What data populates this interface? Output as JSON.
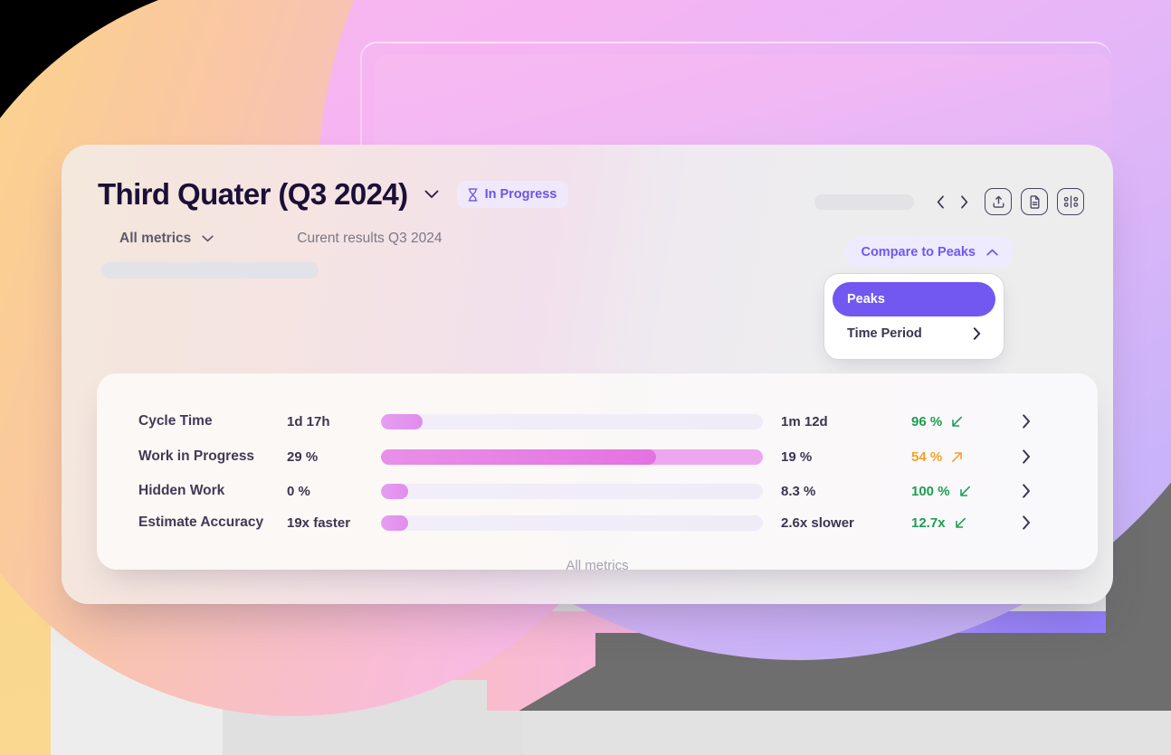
{
  "header": {
    "title": "Third Quater (Q3 2024)",
    "title_chevron_icon": "chevron-down-icon",
    "status_badge": {
      "label": "In Progress",
      "icon": "hourglass-icon",
      "color": "#6c55e8"
    }
  },
  "subheader": {
    "metrics_filter": "All metrics",
    "metrics_filter_chevron_icon": "chevron-down-icon",
    "results_label": "Curent results Q3 2024"
  },
  "toolbar": {
    "prev_icon": "chevron-left-icon",
    "next_icon": "chevron-right-icon",
    "buttons": [
      {
        "name": "share-button",
        "icon": "upload-icon"
      },
      {
        "name": "report-button",
        "icon": "document-icon"
      },
      {
        "name": "connect-button",
        "icon": "share-nodes-icon"
      }
    ]
  },
  "compare": {
    "label": "Compare to Peaks",
    "chevron_icon": "chevron-up-icon",
    "accent": "#7257f0",
    "menu": [
      {
        "label": "Peaks",
        "active": true,
        "chevron": false
      },
      {
        "label": "Time Period",
        "active": false,
        "chevron": true,
        "chevron_icon": "chevron-right-icon"
      }
    ]
  },
  "metrics": {
    "footer_label": "All metrics",
    "rows": [
      {
        "label": "Cycle Time",
        "value": "1d 17h",
        "bar_percent": 11,
        "bar_style": "small",
        "peak": "1m 12d",
        "delta": "96 %",
        "delta_direction": "down",
        "delta_tone": "good",
        "chevron_icon": "chevron-right-icon"
      },
      {
        "label": "Work in Progress",
        "value": "29 %",
        "bar_percent": 72,
        "bar_style": "wide",
        "peak": "19 %",
        "delta": "54 %",
        "delta_direction": "up",
        "delta_tone": "warn",
        "chevron_icon": "chevron-right-icon"
      },
      {
        "label": "Hidden Work",
        "value": "0 %",
        "bar_percent": 7,
        "bar_style": "small",
        "peak": "8.3 %",
        "delta": "100 %",
        "delta_direction": "down",
        "delta_tone": "good",
        "chevron_icon": "chevron-right-icon"
      },
      {
        "label": "Estimate Accuracy",
        "value": "19x faster",
        "bar_percent": 7,
        "bar_style": "small",
        "peak": "2.6x slower",
        "delta": "12.7x",
        "delta_direction": "down",
        "delta_tone": "good",
        "chevron_icon": "chevron-right-icon"
      }
    ]
  },
  "colors": {
    "accent_purple": "#7257f0",
    "good_green": "#1f9d52",
    "warn_orange": "#f0a12b",
    "bar_pink": "#e472e2",
    "title_ink": "#1c0f36"
  }
}
